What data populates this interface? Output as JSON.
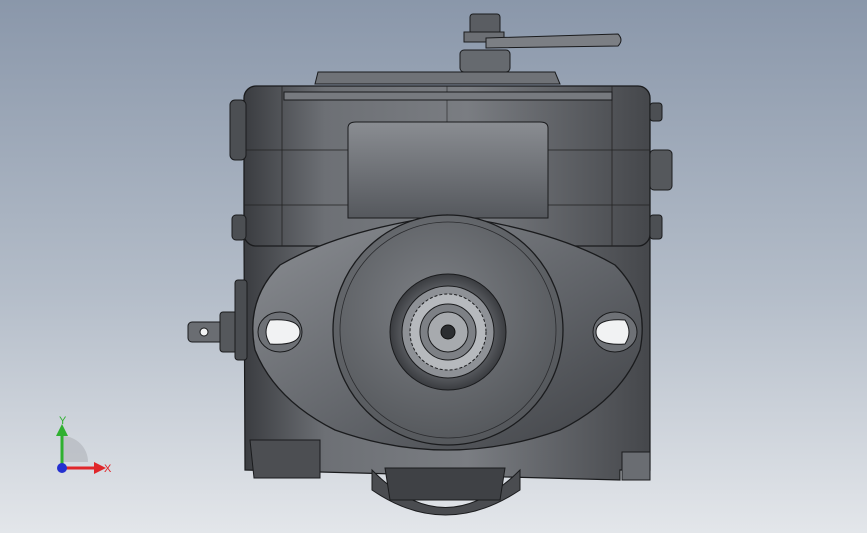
{
  "viewport": {
    "background_top": "#8a97aa",
    "background_bottom": "#e3e6ea"
  },
  "model": {
    "body_color": "#5c5f64",
    "edge_color": "#1a1b1d"
  },
  "triad": {
    "x_label": "X",
    "y_label": "Y",
    "x_color": "#e0262a",
    "y_color": "#2fb030",
    "z_color": "#2430d0"
  }
}
